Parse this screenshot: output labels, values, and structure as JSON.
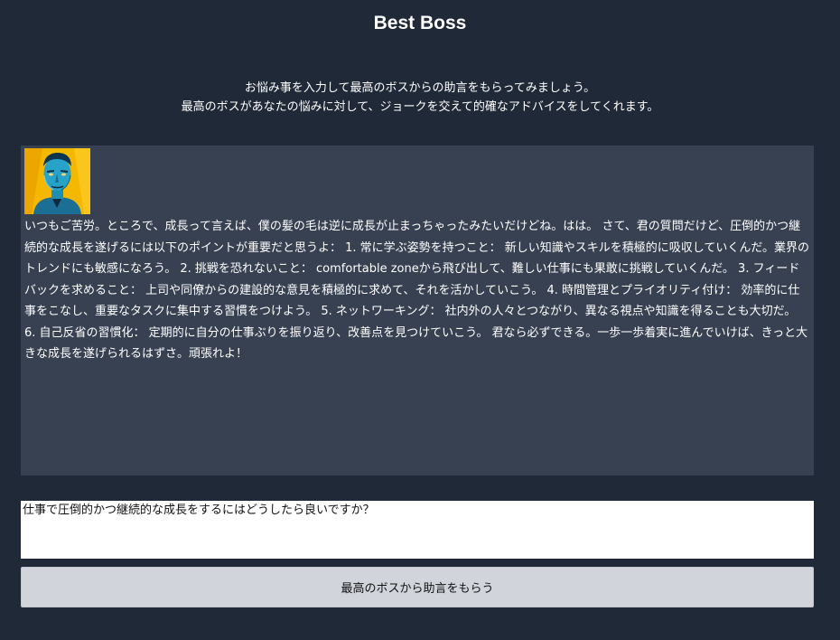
{
  "header": {
    "title": "Best Boss"
  },
  "intro": {
    "line1": "お悩み事を入力して最高のボスからの助言をもらってみましょう。",
    "line2": "最高のボスがあなたの悩みに対して、ジョークを交えて的確なアドバイスをしてくれます。"
  },
  "response": {
    "avatar_icon": "boss-portrait-avatar",
    "text": "いつもご苦労。ところで、成長って言えば、僕の髪の毛は逆に成長が止まっちゃったみたいだけどね。はは。 さて、君の質問だけど、圧倒的かつ継続的な成長を遂げるには以下のポイントが重要だと思うよ： 1. 常に学ぶ姿勢を持つこと： 新しい知識やスキルを積極的に吸収していくんだ。業界のトレンドにも敏感になろう。 2. 挑戦を恐れないこと： comfortable zoneから飛び出して、難しい仕事にも果敢に挑戦していくんだ。 3. フィードバックを求めること： 上司や同僚からの建設的な意見を積極的に求めて、それを活かしていこう。 4. 時間管理とプライオリティ付け： 効率的に仕事をこなし、重要なタスクに集中する習慣をつけよう。 5. ネットワーキング： 社内外の人々とつながり、異なる視点や知識を得ることも大切だ。 6. 自己反省の習慣化： 定期的に自分の仕事ぶりを振り返り、改善点を見つけていこう。 君なら必ずできる。一歩一歩着実に進んでいけば、きっと大きな成長を遂げられるはずさ。頑張れよ！"
  },
  "form": {
    "question_value": "仕事で圧倒的かつ継続的な成長をするにはどうしたら良いですか？",
    "submit_label": "最高のボスから助言をもらう"
  },
  "colors": {
    "background": "#1f2937",
    "panel": "#374151",
    "button": "#d1d5db",
    "avatar_bg": "#f5b800",
    "avatar_face": "#27a3c9"
  }
}
